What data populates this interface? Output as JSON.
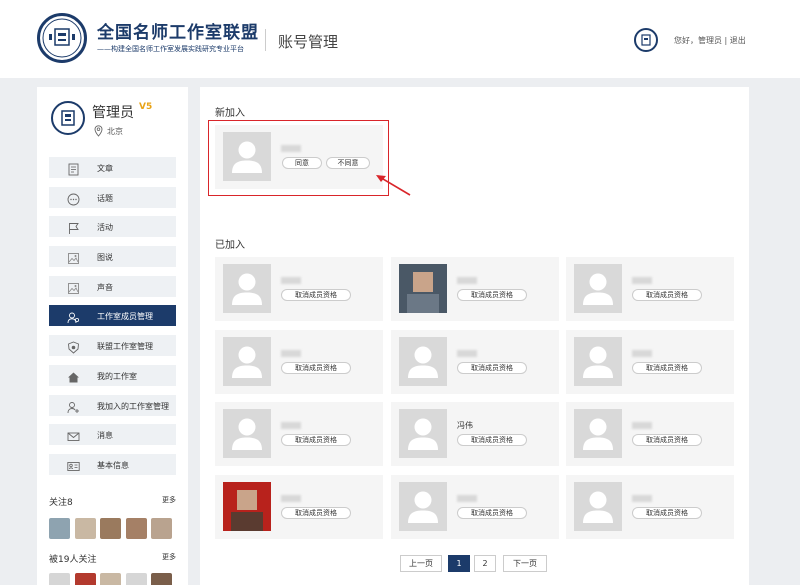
{
  "header": {
    "title": "全国名师工作室联盟",
    "subtitle": "——构建全国名师工作室发展实践研究专业平台",
    "page_title": "账号管理",
    "greeting": "您好，",
    "user": "管理员",
    "sep": "|",
    "logout": "退出"
  },
  "profile": {
    "name": "管理员",
    "vip": "V5",
    "location": "北京"
  },
  "menu": [
    {
      "label": "文章",
      "icon": "document-icon"
    },
    {
      "label": "话题",
      "icon": "chat-bubble-icon"
    },
    {
      "label": "活动",
      "icon": "flag-icon"
    },
    {
      "label": "图说",
      "icon": "image-icon"
    },
    {
      "label": "声音",
      "icon": "image-icon"
    },
    {
      "label": "工作室成员管理",
      "icon": "members-icon",
      "active": true
    },
    {
      "label": "联盟工作室管理",
      "icon": "shield-icon"
    },
    {
      "label": "我的工作室",
      "icon": "home-icon"
    },
    {
      "label": "我加入的工作室管理",
      "icon": "user-add-icon"
    },
    {
      "label": "消息",
      "icon": "mail-icon"
    },
    {
      "label": "基本信息",
      "icon": "id-card-icon"
    }
  ],
  "following": {
    "label": "关注8",
    "more": "更多"
  },
  "followers": {
    "label": "被19人关注",
    "more": "更多"
  },
  "new_join": {
    "title": "新加入",
    "agree": "同意",
    "disagree": "不同意"
  },
  "joined": {
    "title": "已加入",
    "cancel_label": "取消成员资格",
    "members": [
      {
        "name": "",
        "photo": "placeholder"
      },
      {
        "name": "",
        "photo": "photo"
      },
      {
        "name": "",
        "photo": "placeholder"
      },
      {
        "name": "",
        "photo": "placeholder"
      },
      {
        "name": "",
        "photo": "placeholder"
      },
      {
        "name": "",
        "photo": "placeholder"
      },
      {
        "name": "",
        "photo": "placeholder"
      },
      {
        "name": "冯伟",
        "photo": "placeholder"
      },
      {
        "name": "",
        "photo": "placeholder"
      },
      {
        "name": "",
        "photo": "photo"
      },
      {
        "name": "",
        "photo": "placeholder"
      },
      {
        "name": "",
        "photo": "placeholder"
      }
    ]
  },
  "pagination": {
    "prev": "上一页",
    "pages": [
      "1",
      "2"
    ],
    "current": "1",
    "next": "下一页"
  },
  "colors": {
    "brand": "#1c3b6a",
    "highlight": "#d9252a"
  }
}
